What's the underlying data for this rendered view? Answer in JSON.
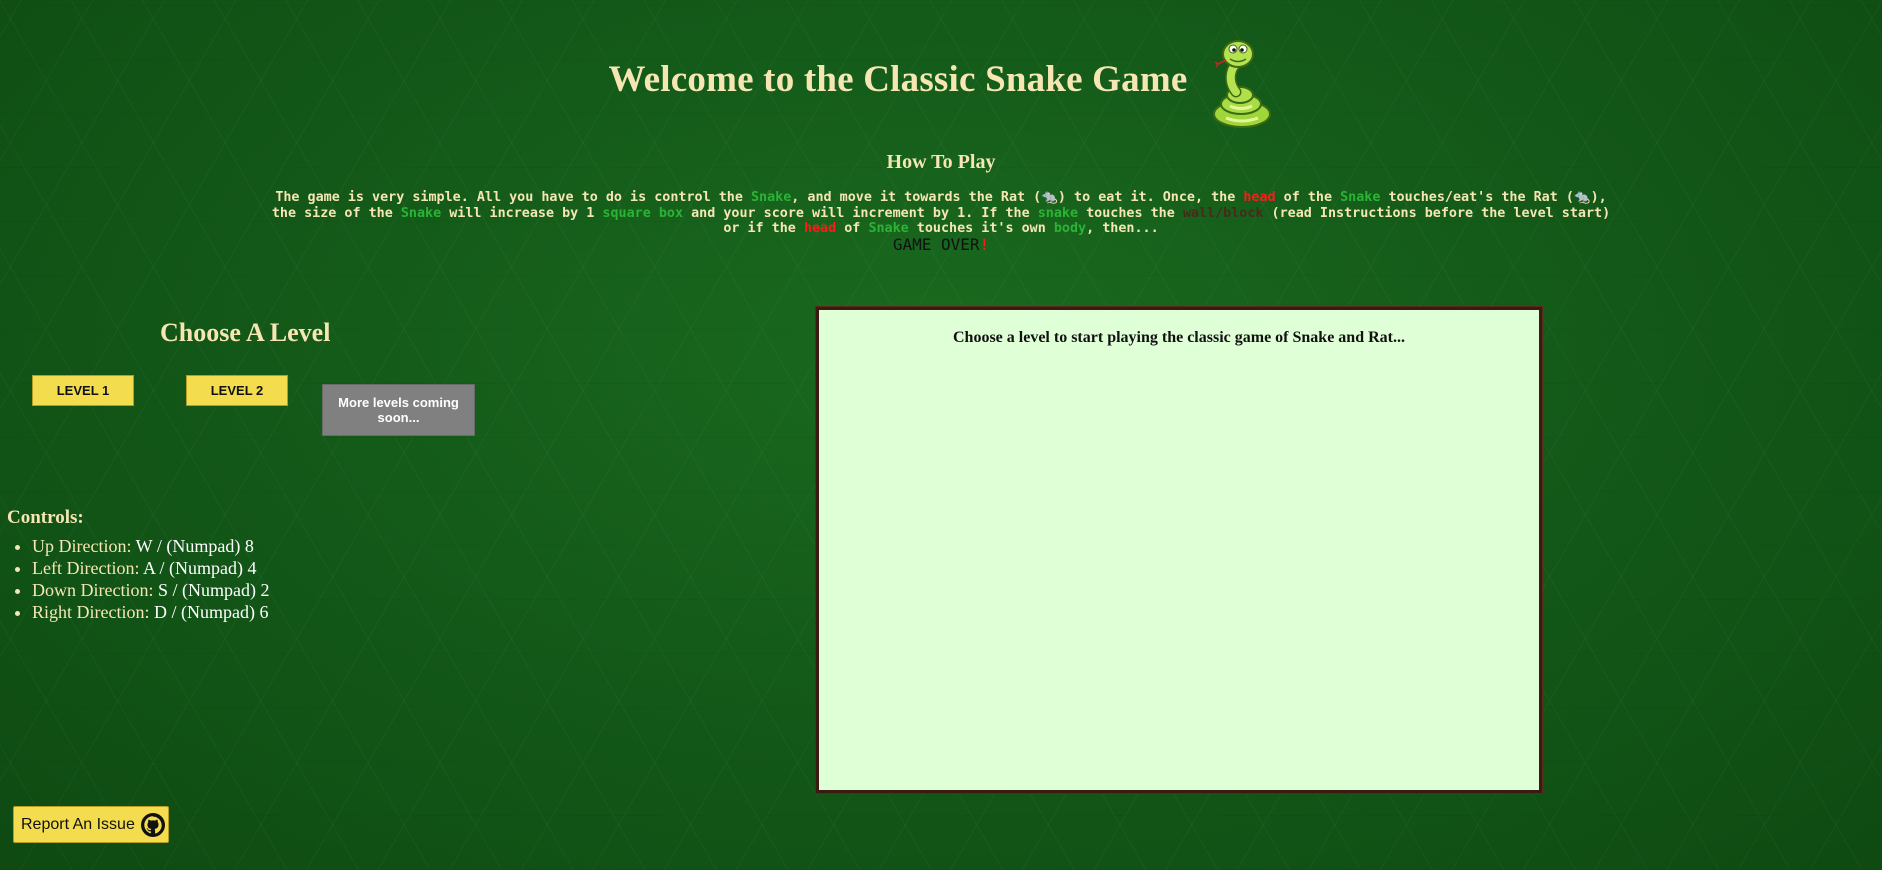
{
  "header": {
    "title": "Welcome to the Classic Snake Game",
    "logo_icon": "cartoon-snake-icon"
  },
  "how_to_play": {
    "title": "How To Play",
    "text": {
      "p1": "The game is very simple. All you have to do is control the ",
      "snake1": "Snake",
      "p2": ", and move it towards the Rat (",
      "rat_icon1": "🐀",
      "p3": ") to eat it. Once, the ",
      "head1": "head",
      "p4": " of the ",
      "snake2": "Snake",
      "p5": " touches/eat's the Rat (",
      "rat_icon2": "🐀",
      "p6": "), the size of the ",
      "snake3": "Snake",
      "p7": " will increase by 1 ",
      "square_box": "square box",
      "p8": " and your score will increment by 1. If the ",
      "snake4": "snake",
      "p9": " touches the ",
      "wall_block": "wall/block",
      "p10": " (read Instructions before the level start) or if the ",
      "head2": "head",
      "p11": " of ",
      "snake5": "Snake",
      "p12": " touches it's own ",
      "body": "body",
      "p13": ", then..."
    },
    "game_over": "GAME OVER",
    "game_over_bang": "!"
  },
  "levels": {
    "title": "Choose A Level",
    "level1": "LEVEL 1",
    "level2": "LEVEL 2",
    "more": "More levels coming soon..."
  },
  "controls": {
    "title": "Controls:",
    "items": [
      {
        "label": "Up Direction:",
        "keys": "W / (Numpad) 8"
      },
      {
        "label": "Left Direction:",
        "keys": "A / (Numpad) 4"
      },
      {
        "label": "Down Direction:",
        "keys": "S / (Numpad) 2"
      },
      {
        "label": "Right Direction:",
        "keys": "D / (Numpad) 6"
      }
    ]
  },
  "board": {
    "message": "Choose a level to start playing the classic game of Snake and Rat..."
  },
  "report": {
    "label": "Report An Issue",
    "icon": "github-icon"
  },
  "colors": {
    "background": "#145a19",
    "accent_yellow": "#f3dc4d",
    "title_text": "#f5e6b3",
    "snake_word": "#2bb336",
    "head_word": "#ff1a1a",
    "board_bg": "#dfffd6",
    "board_border": "#3b1a12"
  }
}
